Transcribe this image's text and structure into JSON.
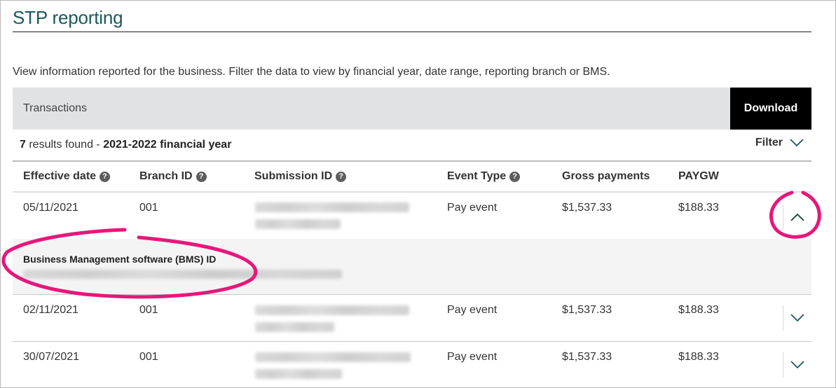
{
  "page": {
    "title": "STP reporting",
    "intro": "View information reported for the business. Filter the data to view by financial year, date range, reporting branch or BMS."
  },
  "transactions_bar": {
    "title": "Transactions",
    "download_label": "Download"
  },
  "results": {
    "count": "7",
    "found_text": " results found - ",
    "period": "2021-2022 financial year",
    "filter_label": "Filter",
    "filter_icon": "chevron-down-icon"
  },
  "table": {
    "columns": [
      {
        "label": "Effective date",
        "help_icon": "question-icon"
      },
      {
        "label": "Branch ID",
        "help_icon": "question-icon"
      },
      {
        "label": "Submission ID",
        "help_icon": "question-icon"
      },
      {
        "label": "Event Type",
        "help_icon": "question-icon"
      },
      {
        "label": "Gross payments"
      },
      {
        "label": "PAYGW"
      }
    ],
    "rows": [
      {
        "effective_date": "05/11/2021",
        "branch_id": "001",
        "submission_id": "[redacted]",
        "event_type": "Pay event",
        "gross_payments": "$1,537.33",
        "paygw": "$188.33",
        "expanded": true,
        "toggle_icon": "chevron-up-icon"
      },
      {
        "effective_date": "02/11/2021",
        "branch_id": "001",
        "submission_id": "[redacted]",
        "event_type": "Pay event",
        "gross_payments": "$1,537.33",
        "paygw": "$188.33",
        "expanded": false,
        "toggle_icon": "chevron-down-icon"
      },
      {
        "effective_date": "30/07/2021",
        "branch_id": "001",
        "submission_id": "[redacted]",
        "event_type": "Pay event",
        "gross_payments": "$1,537.33",
        "paygw": "$188.33",
        "expanded": false,
        "toggle_icon": "chevron-down-icon"
      }
    ],
    "expanded_detail": {
      "label": "Business Management software (BMS) ID",
      "value": "[redacted]"
    }
  },
  "colors": {
    "title": "#1a5a5a",
    "chevron": "#1a5a5a",
    "annotation": "#e5187a",
    "bar_bg": "#e1e2e3",
    "detail_bg": "#f4f4f4"
  }
}
